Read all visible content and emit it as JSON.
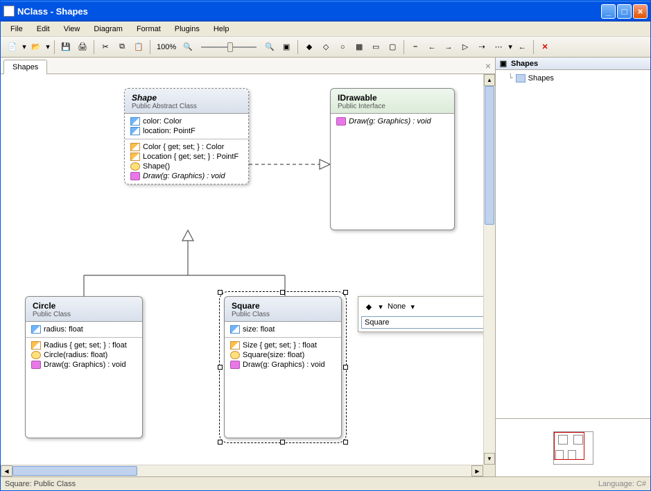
{
  "window": {
    "title": "NClass - Shapes"
  },
  "menu": {
    "items": [
      "File",
      "Edit",
      "View",
      "Diagram",
      "Format",
      "Plugins",
      "Help"
    ]
  },
  "toolbar": {
    "zoom": "100%"
  },
  "tabs": {
    "active": "Shapes"
  },
  "side": {
    "title": "Shapes",
    "tree": [
      {
        "label": "Shapes"
      }
    ]
  },
  "status": {
    "left": "Square: Public Class",
    "right": "Language: C#"
  },
  "float": {
    "modifier": "None",
    "value": "Square"
  },
  "classes": {
    "shape": {
      "name": "Shape",
      "stereo": "Public Abstract Class",
      "fields": [
        "color: Color",
        "location: PointF"
      ],
      "members": [
        {
          "kind": "prop",
          "text": "Color { get; set; } : Color"
        },
        {
          "kind": "prop",
          "text": "Location { get; set; } : PointF"
        },
        {
          "kind": "ctor",
          "text": "Shape()"
        },
        {
          "kind": "method",
          "text": "Draw(g: Graphics) : void",
          "italic": true
        }
      ]
    },
    "idrawable": {
      "name": "IDrawable",
      "stereo": "Public Interface",
      "members": [
        {
          "kind": "method",
          "text": "Draw(g: Graphics) : void",
          "italic": true
        }
      ]
    },
    "circle": {
      "name": "Circle",
      "stereo": "Public Class",
      "fields": [
        "radius: float"
      ],
      "members": [
        {
          "kind": "prop",
          "text": "Radius { get; set; } : float"
        },
        {
          "kind": "ctor",
          "text": "Circle(radius: float)"
        },
        {
          "kind": "method",
          "text": "Draw(g: Graphics) : void"
        }
      ]
    },
    "square": {
      "name": "Square",
      "stereo": "Public Class",
      "fields": [
        "size: float"
      ],
      "members": [
        {
          "kind": "prop",
          "text": "Size { get; set; } : float"
        },
        {
          "kind": "ctor",
          "text": "Square(size: float)"
        },
        {
          "kind": "method",
          "text": "Draw(g: Graphics) : void"
        }
      ]
    }
  }
}
